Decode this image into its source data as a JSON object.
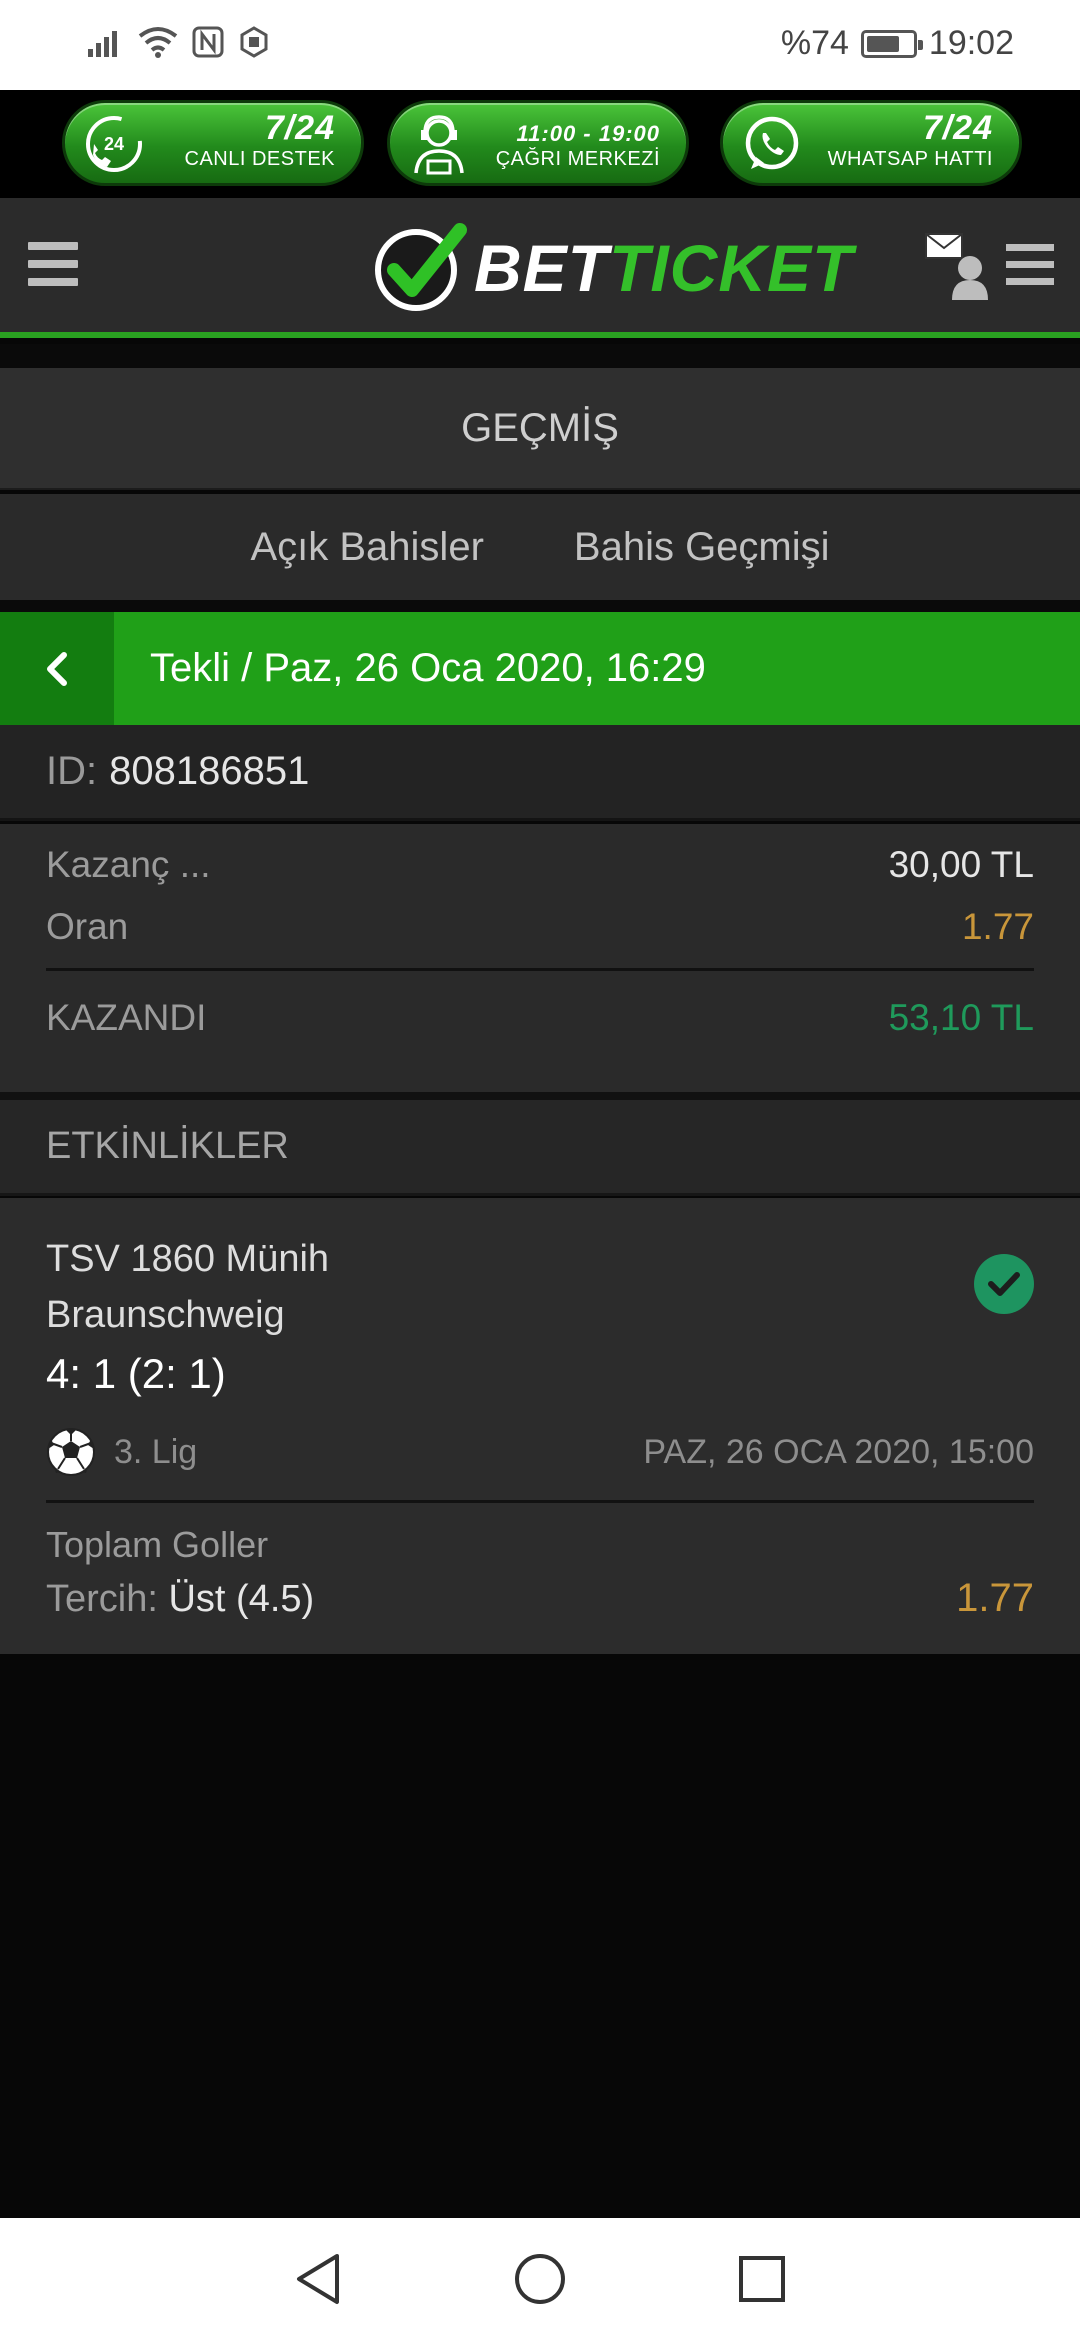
{
  "status_bar": {
    "battery_text": "%74",
    "battery_level": 0.74,
    "time": "19:02",
    "icons": [
      "signal-icon",
      "wifi-icon",
      "nfc-icon",
      "app-notification-icon"
    ]
  },
  "support": [
    {
      "big": "7/24",
      "small": "CANLI DESTEK",
      "icon": "phone-24-icon"
    },
    {
      "big": "11:00 - 19:00",
      "small": "ÇAĞRI MERKEZİ",
      "icon": "call-center-agent-icon"
    },
    {
      "big": "7/24",
      "small": "WHATSAP HATTI",
      "icon": "whatsapp-icon"
    }
  ],
  "header": {
    "logo_part1": "BET",
    "logo_part2": "TICKET",
    "icons": [
      "hamburger-menu-icon",
      "user-mail-icon"
    ]
  },
  "history": {
    "title": "GEÇMİŞ",
    "tabs": [
      "Açık Bahisler",
      "Bahis Geçmişi"
    ]
  },
  "bet": {
    "title": "Tekli / Paz, 26 Oca 2020, 16:29",
    "id_label": "ID:",
    "id_value": "808186851",
    "summary": [
      {
        "label": "Kazanç ...",
        "value": "30,00 TL"
      },
      {
        "label": "Oran",
        "value": "1.77"
      }
    ],
    "result_label": "KAZANDI",
    "result_value": "53,10 TL"
  },
  "events": {
    "title": "ETKİNLİKLER",
    "items": [
      {
        "team1": "TSV 1860 Münih",
        "team2": "Braunschweig",
        "score": "4: 1 (2: 1)",
        "league": "3. Lig",
        "date": "PAZ, 26 OCA 2020, 15:00",
        "market": "Toplam Goller",
        "pick_label": "Tercih:",
        "pick_value": "Üst (4.5)",
        "odds": "1.77"
      }
    ]
  },
  "colors": {
    "brand_green": "#20a018",
    "gold": "#c9963a",
    "win_green": "#1f9a5b"
  }
}
